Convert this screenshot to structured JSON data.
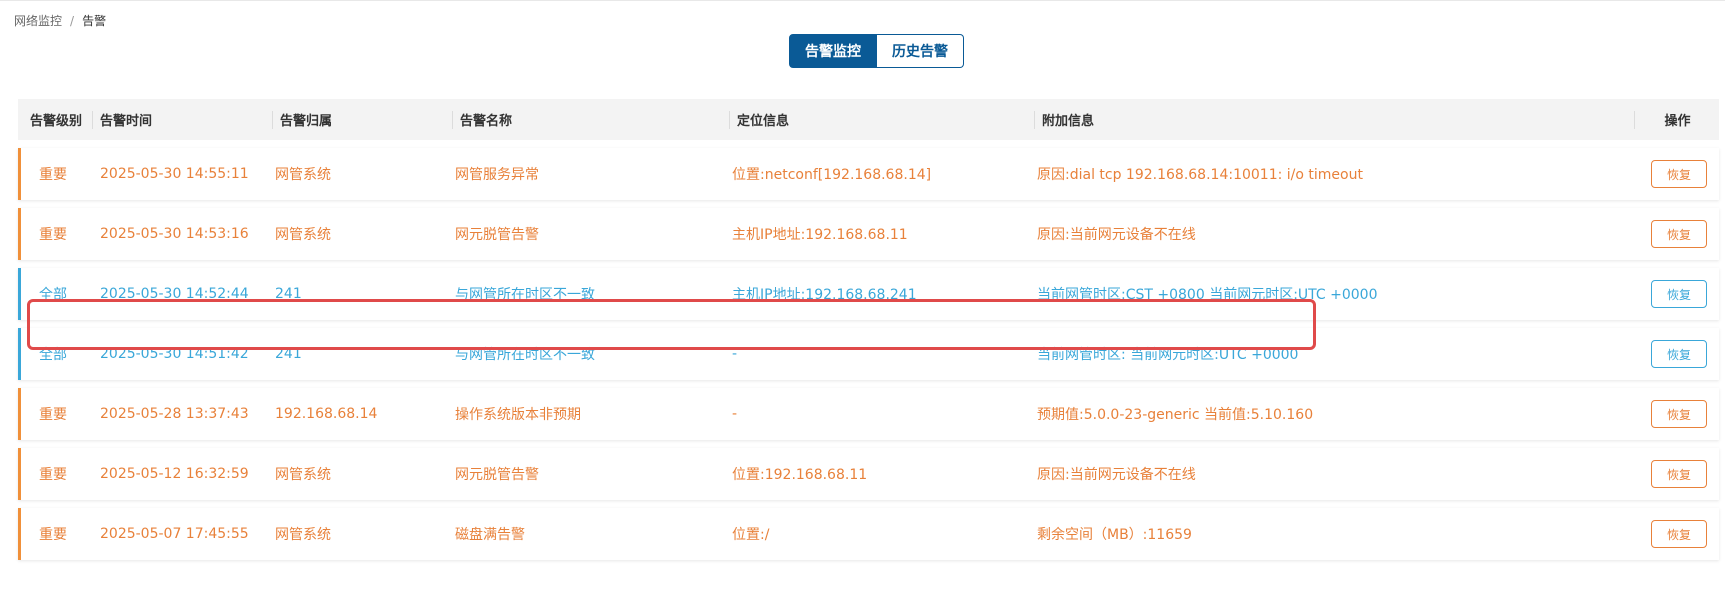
{
  "breadcrumb": {
    "parent": "网络监控",
    "separator": "/",
    "current": "告警"
  },
  "tabs": [
    {
      "label": "告警监控",
      "active": true
    },
    {
      "label": "历史告警",
      "active": false
    }
  ],
  "table": {
    "headers": {
      "level": "告警级别",
      "time": "告警时间",
      "owner": "告警归属",
      "name": "告警名称",
      "location": "定位信息",
      "extra": "附加信息",
      "operation": "操作"
    },
    "rows": [
      {
        "level": "重要",
        "time": "2025-05-30 14:55:11",
        "owner": "网管系统",
        "name": "网管服务异常",
        "location": "位置:netconf[192.168.68.14]",
        "extra": "原因:dial tcp 192.168.68.14:10011: i/o timeout",
        "action": "恢复",
        "color": "#e8813a"
      },
      {
        "level": "重要",
        "time": "2025-05-30 14:53:16",
        "owner": "网管系统",
        "name": "网元脱管告警",
        "location": "主机IP地址:192.168.68.11",
        "extra": "原因:当前网元设备不在线",
        "action": "恢复",
        "color": "#e8813a"
      },
      {
        "level": "全部",
        "time": "2025-05-30 14:52:44",
        "owner": "241",
        "name": "与网管所在时区不一致",
        "location": "主机IP地址:192.168.68.241",
        "extra": "当前网管时区:CST +0800 当前网元时区:UTC +0000",
        "action": "恢复",
        "color": "#3aa7d9"
      },
      {
        "level": "全部",
        "time": "2025-05-30 14:51:42",
        "owner": "241",
        "name": "与网管所在时区不一致",
        "location": "-",
        "extra": "当前网管时区: 当前网元时区:UTC +0000",
        "action": "恢复",
        "color": "#3aa7d9"
      },
      {
        "level": "重要",
        "time": "2025-05-28 13:37:43",
        "owner": "192.168.68.14",
        "name": "操作系统版本非预期",
        "location": "-",
        "extra": "预期值:5.0.0-23-generic 当前值:5.10.160",
        "action": "恢复",
        "color": "#e8813a"
      },
      {
        "level": "重要",
        "time": "2025-05-12 16:32:59",
        "owner": "网管系统",
        "name": "网元脱管告警",
        "location": "位置:192.168.68.11",
        "extra": "原因:当前网元设备不在线",
        "action": "恢复",
        "color": "#e8813a"
      },
      {
        "level": "重要",
        "time": "2025-05-07 17:45:55",
        "owner": "网管系统",
        "name": "磁盘满告警",
        "location": "位置:/",
        "extra": "剩余空间（MB）:11659",
        "action": "恢复",
        "color": "#e8813a"
      }
    ]
  },
  "highlight": {
    "color": "#e04a4a",
    "row_index": 3
  }
}
